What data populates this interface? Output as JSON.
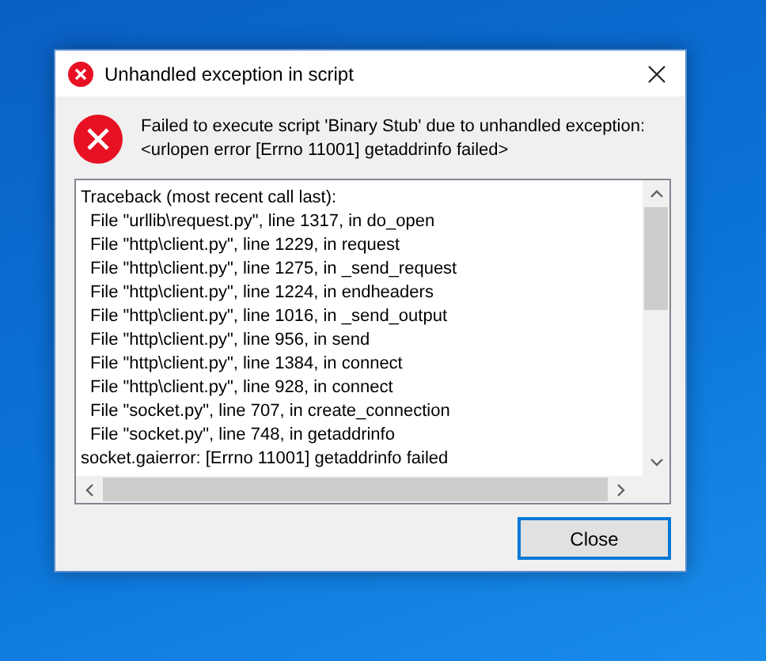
{
  "dialog": {
    "title": "Unhandled exception in script",
    "message": "Failed to execute script 'Binary Stub' due to unhandled exception: <urlopen error [Errno 11001] getaddrinfo failed>",
    "traceback": [
      {
        "kind": "header",
        "text": "Traceback (most recent call last):"
      },
      {
        "kind": "frame",
        "text": "File \"urllib\\request.py\", line 1317, in do_open"
      },
      {
        "kind": "frame",
        "text": "File \"http\\client.py\", line 1229, in request"
      },
      {
        "kind": "frame",
        "text": "File \"http\\client.py\", line 1275, in _send_request"
      },
      {
        "kind": "frame",
        "text": "File \"http\\client.py\", line 1224, in endheaders"
      },
      {
        "kind": "frame",
        "text": "File \"http\\client.py\", line 1016, in _send_output"
      },
      {
        "kind": "frame",
        "text": "File \"http\\client.py\", line 956, in send"
      },
      {
        "kind": "frame",
        "text": "File \"http\\client.py\", line 1384, in connect"
      },
      {
        "kind": "frame",
        "text": "File \"http\\client.py\", line 928, in connect"
      },
      {
        "kind": "frame",
        "text": "File \"socket.py\", line 707, in create_connection"
      },
      {
        "kind": "frame",
        "text": "File \"socket.py\", line 748, in getaddrinfo"
      },
      {
        "kind": "header",
        "text": "socket.gaierror: [Errno 11001] getaddrinfo failed"
      }
    ],
    "buttons": [
      "Close"
    ]
  }
}
